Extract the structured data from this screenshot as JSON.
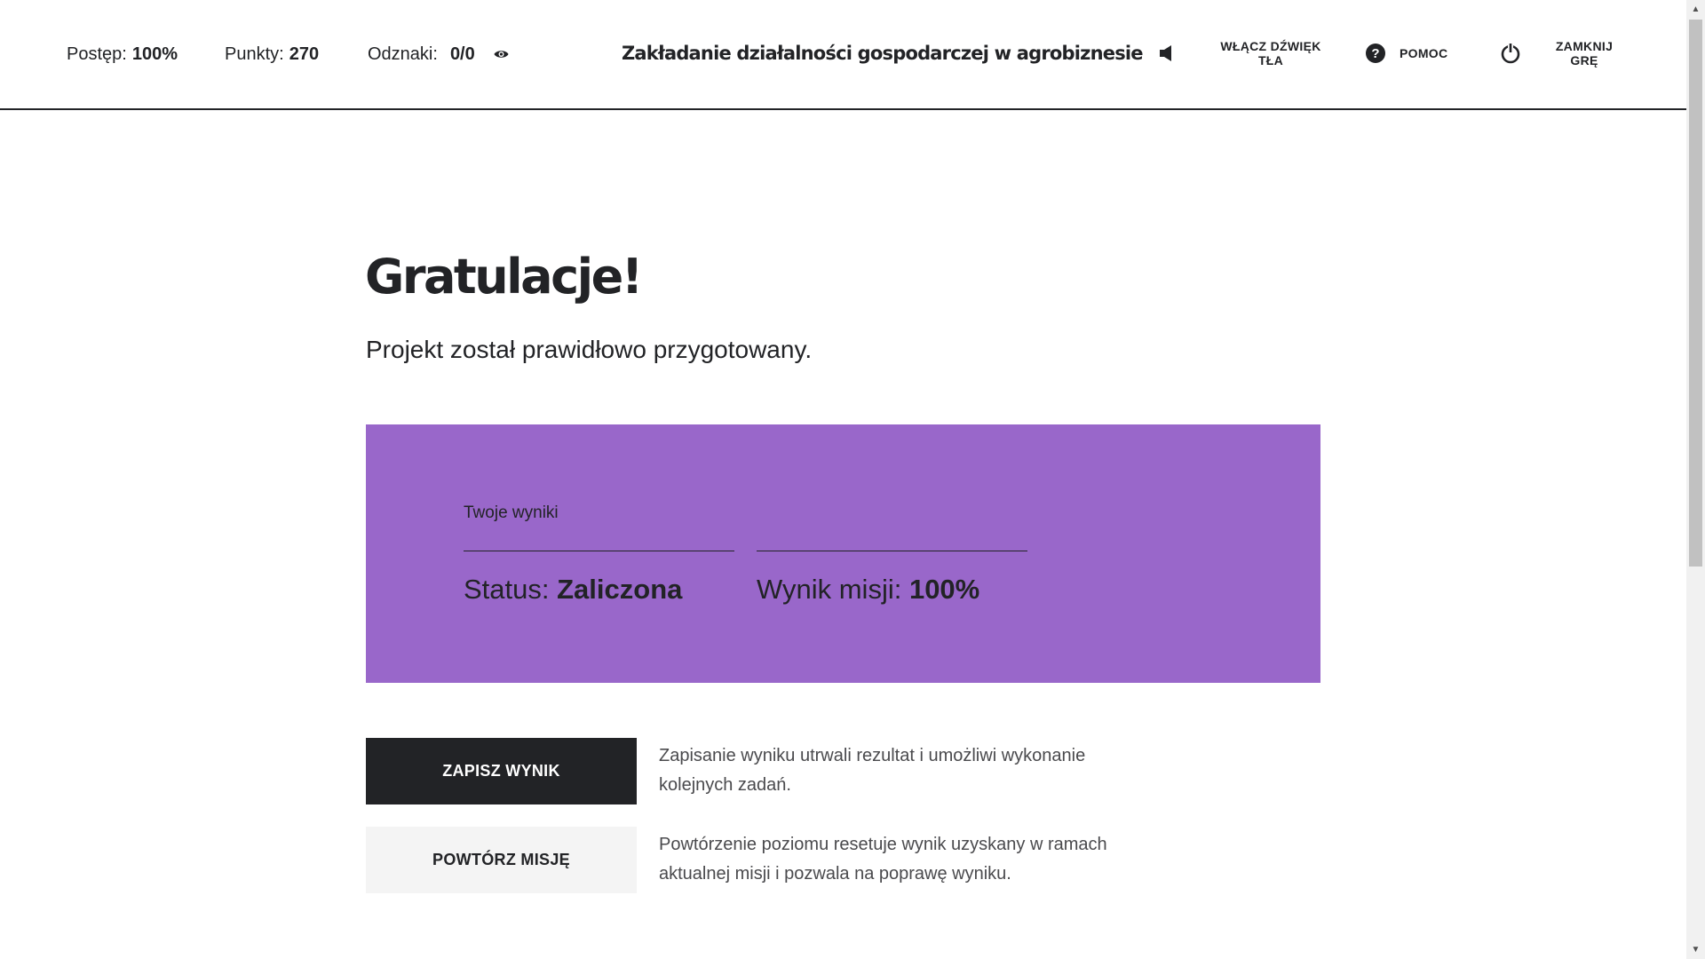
{
  "header": {
    "progress": {
      "label": "Postęp:",
      "value": "100%"
    },
    "points": {
      "label": "Punkty:",
      "value": "270"
    },
    "badges": {
      "label": "Odznaki:",
      "value": "0/0"
    },
    "title": "Zakładanie działalności gospodarczej w agrobiznesie",
    "buttons": {
      "sound": "WŁĄCZ DŹWIĘK TŁA",
      "help": "POMOC",
      "close": "ZAMKNIJ GRĘ"
    }
  },
  "main": {
    "title": "Gratulacje!",
    "subtitle": "Projekt został prawidłowo przygotowany.",
    "results": {
      "heading": "Twoje wyniki",
      "status_label": "Status:",
      "status_value": "Zaliczona",
      "score_label": "Wynik misji:",
      "score_value": "100%"
    },
    "actions": [
      {
        "label": "ZAPISZ WYNIK",
        "description": "Zapisanie wyniku utrwali rezultat i umożliwi wykonanie kolejnych zadań."
      },
      {
        "label": "POWTÓRZ MISJĘ",
        "description": "Powtórzenie poziomu resetuje wynik uzyskany w ramach aktualnej misji i pozwala na poprawę wyniku."
      }
    ]
  },
  "colors": {
    "accent_panel": "#9967ca",
    "dark": "#222326",
    "light_button": "#f4f4f4"
  },
  "icons": [
    "eye-icon",
    "speaker-icon",
    "help-icon",
    "power-icon"
  ]
}
